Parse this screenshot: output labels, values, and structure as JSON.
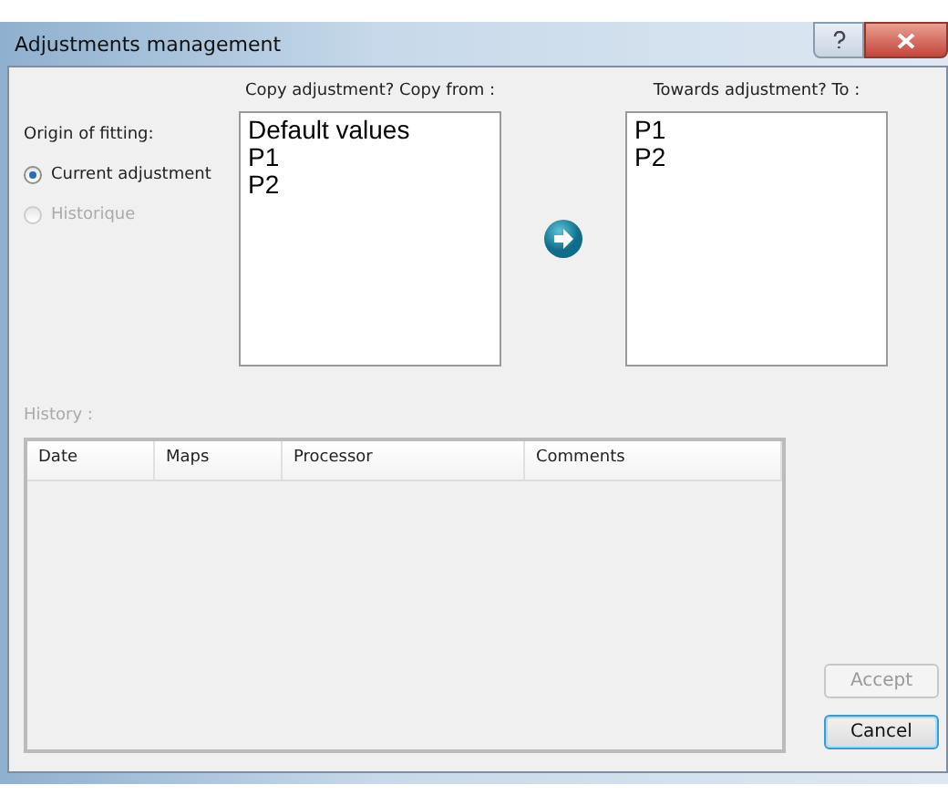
{
  "window": {
    "title": "Adjustments management"
  },
  "origin": {
    "label": "Origin of fitting:",
    "options": [
      {
        "label": "Current adjustment",
        "selected": true,
        "disabled": false
      },
      {
        "label": "Historique",
        "selected": false,
        "disabled": true
      }
    ]
  },
  "copy_from": {
    "heading": "Copy adjustment? Copy from :",
    "items": [
      "Default values",
      "P1",
      "P2"
    ]
  },
  "copy_to": {
    "heading": "Towards adjustment? To :",
    "items": [
      "P1",
      "P2"
    ]
  },
  "history": {
    "label": "History :",
    "disabled": true,
    "columns": [
      "Date",
      "Maps",
      "Processor",
      "Comments"
    ]
  },
  "buttons": [
    {
      "label": "Accept",
      "disabled": true
    },
    {
      "label": "Cancel",
      "disabled": false
    }
  ]
}
